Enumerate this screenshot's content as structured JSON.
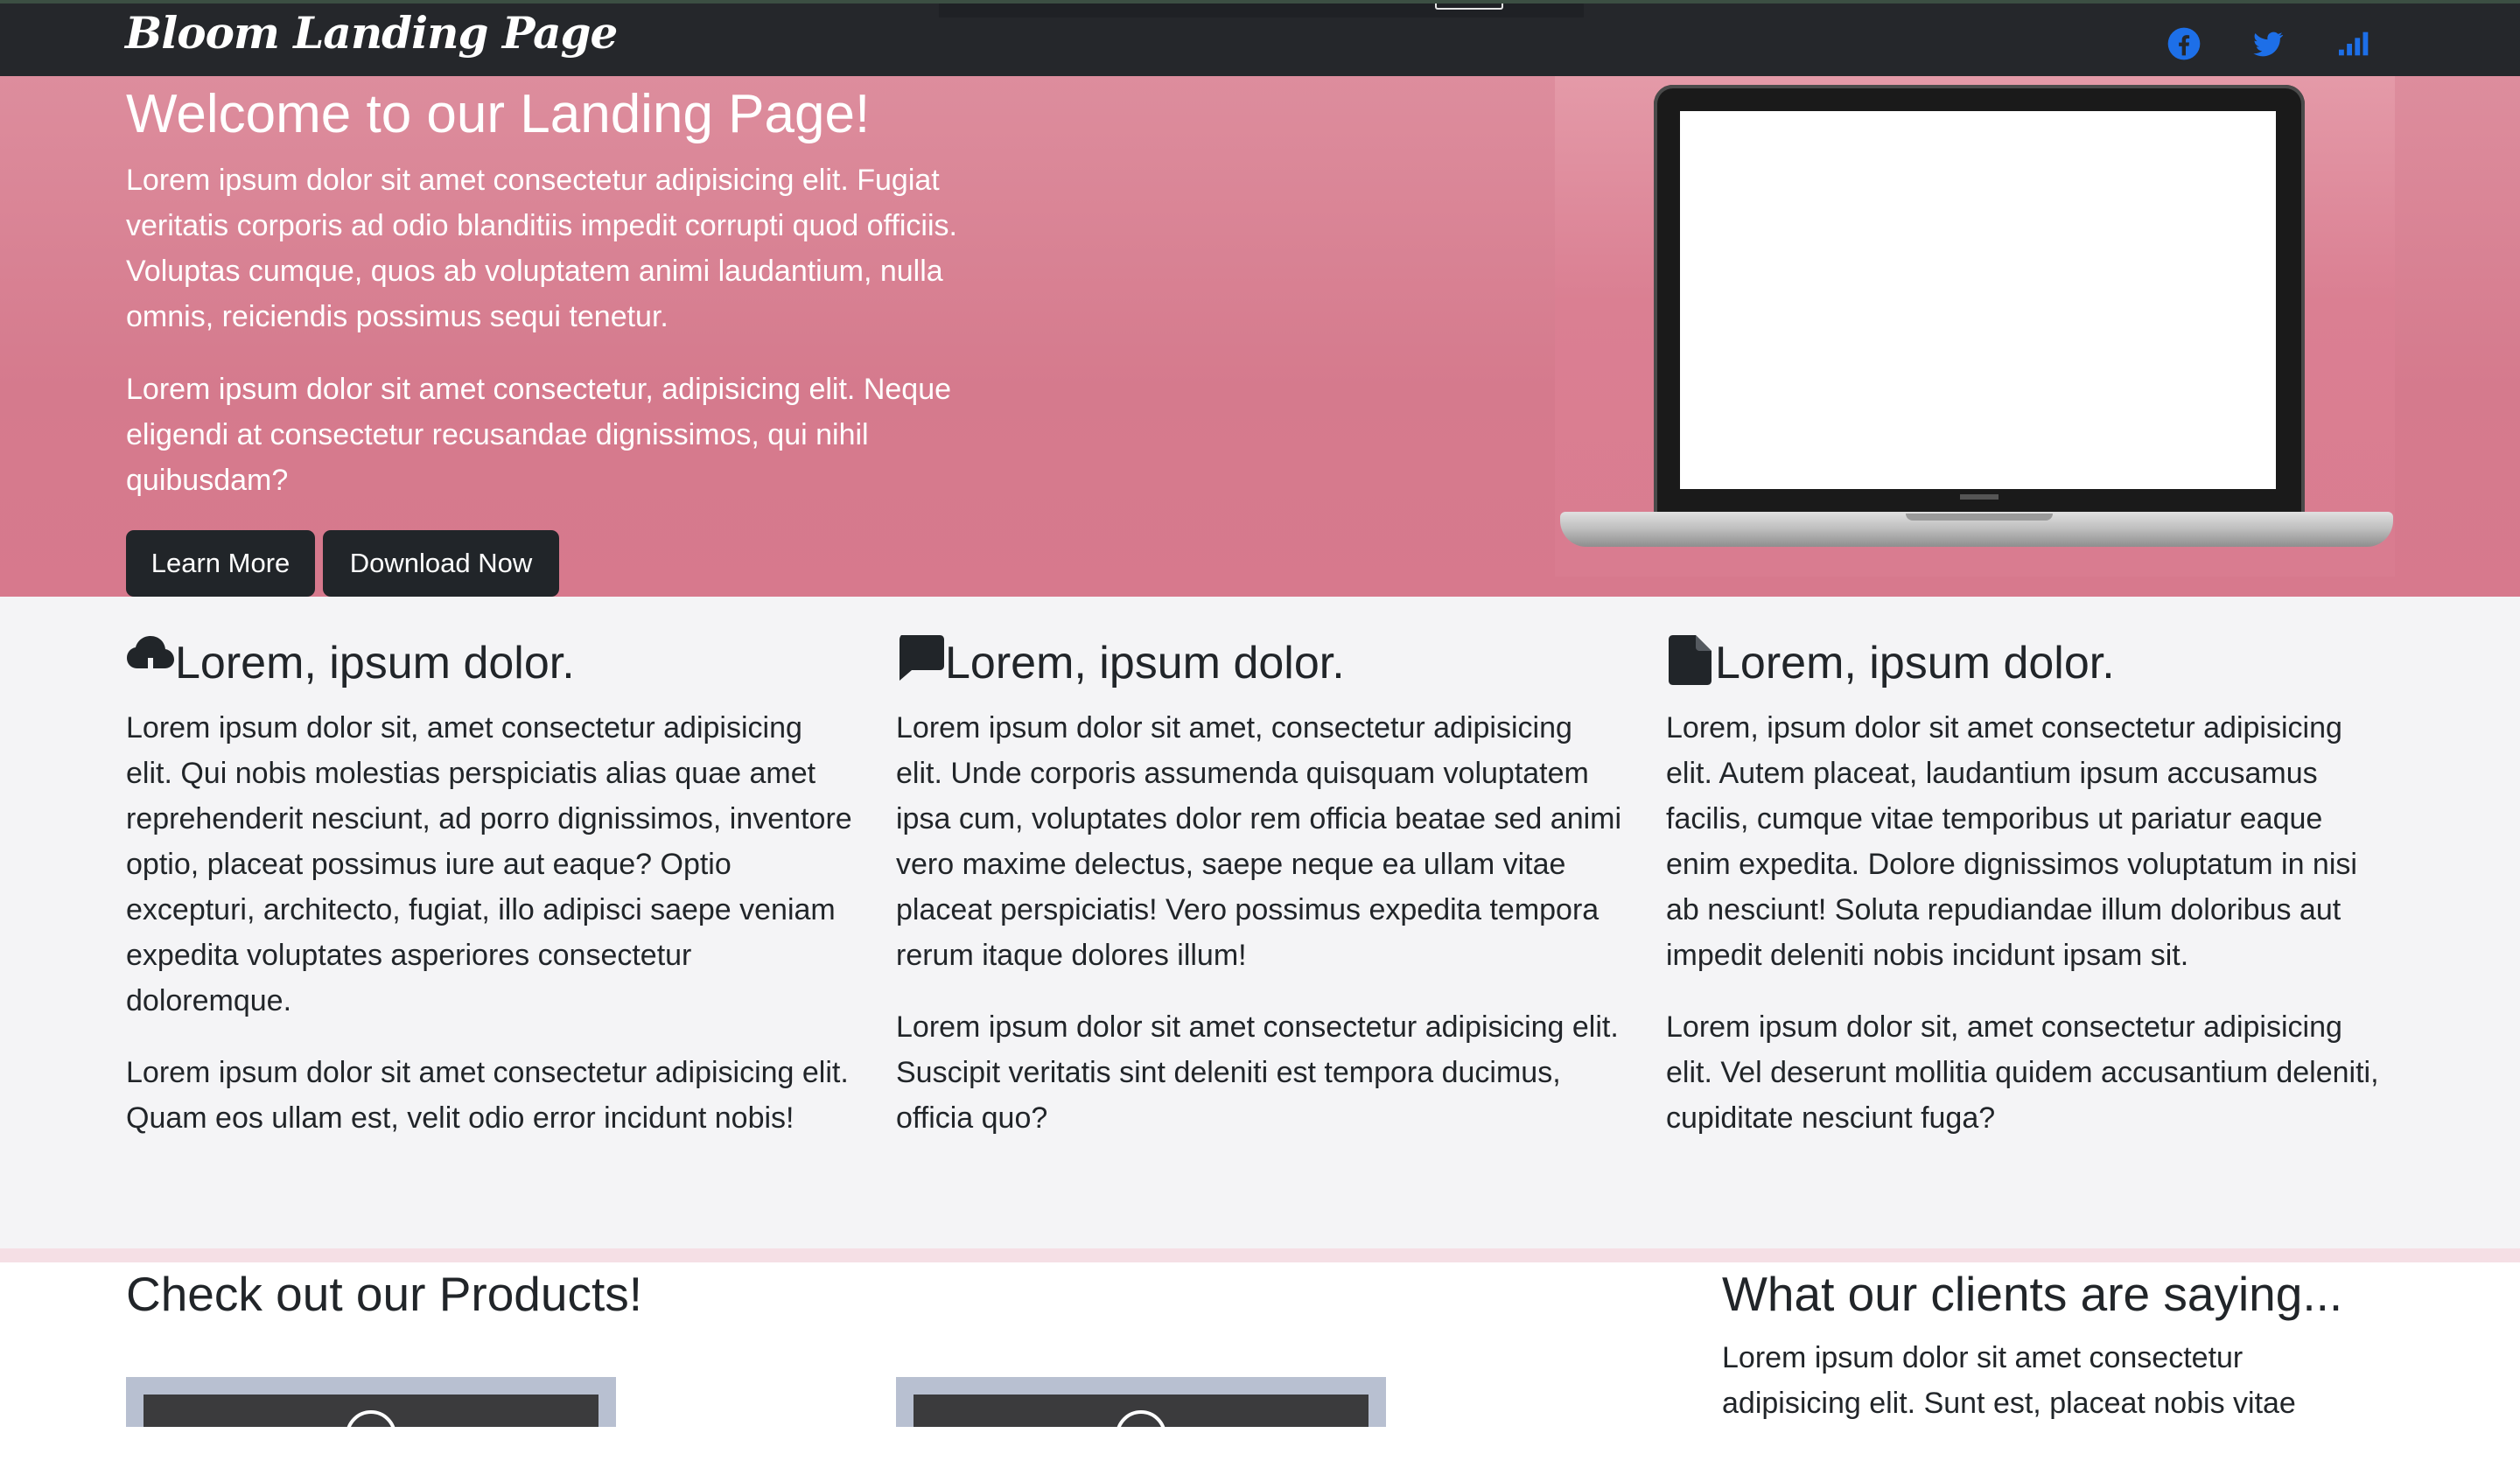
{
  "navbar": {
    "brand": "Bloom Landing Page",
    "social_icons": [
      "facebook-icon",
      "twitter-icon",
      "signal-icon"
    ],
    "icon_color": "#1d6fe8"
  },
  "hero": {
    "title": "Welcome to our Landing Page!",
    "paragraph_1": "Lorem ipsum dolor sit amet consectetur adipisicing elit. Fugiat veritatis corporis ad odio blanditiis impedit corrupti quod officiis. Voluptas cumque, quos ab voluptatem animi laudantium, nulla omnis, reiciendis possimus sequi tenetur.",
    "paragraph_2": "Lorem ipsum dolor sit amet consectetur, adipisicing elit. Neque eligendi at consectetur recusandae dignissimos, qui nihil quibusdam?",
    "learn_more_label": "Learn More",
    "download_label": "Download Now",
    "background_color": "#d8808f"
  },
  "features": [
    {
      "icon": "cloud-download-icon",
      "title": "Lorem, ipsum dolor.",
      "paragraph_1": "Lorem ipsum dolor sit, amet consectetur adipisicing elit. Qui nobis molestias perspiciatis alias quae amet reprehenderit nesciunt, ad porro dignissimos, inventore optio, placeat possimus iure aut eaque? Optio excepturi, architecto, fugiat, illo adipisci saepe veniam expedita voluptates asperiores consectetur doloremque.",
      "paragraph_2": "Lorem ipsum dolor sit amet consectetur adipisicing elit. Quam eos ullam est, velit odio error incidunt nobis!"
    },
    {
      "icon": "chat-bubble-icon",
      "title": "Lorem, ipsum dolor.",
      "paragraph_1": "Lorem ipsum dolor sit amet, consectetur adipisicing elit. Unde corporis assumenda quisquam voluptatem ipsa cum, voluptates dolor rem officia beatae sed animi vero maxime delectus, saepe neque ea ullam vitae placeat perspiciatis! Vero possimus expedita tempora rerum itaque dolores illum!",
      "paragraph_2": "Lorem ipsum dolor sit amet consectetur adipisicing elit. Suscipit veritatis sint deleniti est tempora ducimus, officia quo?"
    },
    {
      "icon": "document-icon",
      "title": "Lorem, ipsum dolor.",
      "paragraph_1": "Lorem, ipsum dolor sit amet consectetur adipisicing elit. Autem placeat, laudantium ipsum accusamus facilis, cumque vitae temporibus ut pariatur eaque enim expedita. Dolore dignissimos voluptatum in nisi ab nesciunt! Soluta repudiandae illum doloribus aut impedit deleniti nobis incidunt ipsam sit.",
      "paragraph_2": "Lorem ipsum dolor sit, amet consectetur adipisicing elit. Vel deserunt mollitia quidem accusantium deleniti, cupiditate nesciunt fuga?"
    }
  ],
  "products": {
    "title": "Check out our Products!"
  },
  "clients": {
    "title": "What our clients are saying...",
    "paragraph": "Lorem ipsum dolor sit amet consectetur adipisicing elit. Sunt est, placeat nobis vitae"
  }
}
